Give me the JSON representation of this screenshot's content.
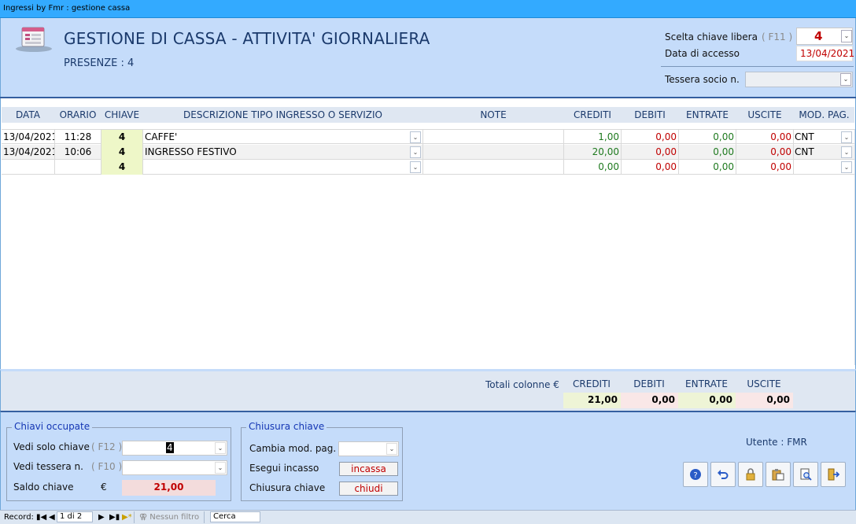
{
  "window": {
    "title": "Ingressi by Fmr : gestione cassa"
  },
  "header": {
    "title": "GESTIONE DI CASSA - ATTIVITA' GIORNALIERA",
    "presenze": "PRESENZE : 4",
    "scelta_label": "Scelta chiave libera",
    "scelta_hint": "( F11 )",
    "scelta_value": "4",
    "data_label": "Data di accesso",
    "data_value": "13/04/2021",
    "tessera_label": "Tessera socio n.",
    "tessera_value": ""
  },
  "grid": {
    "columns": [
      "DATA",
      "ORARIO",
      "CHIAVE",
      "DESCRIZIONE TIPO INGRESSO O SERVIZIO",
      "NOTE",
      "CREDITI",
      "DEBITI",
      "ENTRATE",
      "USCITE",
      "MOD. PAG."
    ],
    "rows": [
      {
        "data": "13/04/2021",
        "orario": "11:28",
        "chiave": "4",
        "descrizione": "CAFFE'",
        "note": "",
        "crediti": "1,00",
        "debiti": "0,00",
        "entrate": "0,00",
        "uscite": "0,00",
        "mod_pag": "CNT"
      },
      {
        "data": "13/04/2021",
        "orario": "10:06",
        "chiave": "4",
        "descrizione": "INGRESSO FESTIVO",
        "note": "",
        "crediti": "20,00",
        "debiti": "0,00",
        "entrate": "0,00",
        "uscite": "0,00",
        "mod_pag": "CNT"
      },
      {
        "data": "",
        "orario": "",
        "chiave": "4",
        "descrizione": "",
        "note": "",
        "crediti": "0,00",
        "debiti": "0,00",
        "entrate": "0,00",
        "uscite": "0,00",
        "mod_pag": ""
      }
    ]
  },
  "totals": {
    "label": "Totali colonne €",
    "headers": [
      "CREDITI",
      "DEBITI",
      "ENTRATE",
      "USCITE"
    ],
    "crediti": "21,00",
    "debiti": "0,00",
    "entrate": "0,00",
    "uscite": "0,00"
  },
  "chiavi_occupate": {
    "legend": "Chiavi occupate",
    "vedi_chiave_label": "Vedi solo chiave",
    "vedi_chiave_hint": "( F12 )",
    "vedi_chiave_value": "4",
    "vedi_tessera_label": "Vedi tessera n.",
    "vedi_tessera_hint": "( F10 )",
    "saldo_label": "Saldo chiave",
    "saldo_currency": "€",
    "saldo_value": "21,00"
  },
  "chiusura": {
    "legend": "Chiusura chiave",
    "cambia_label": "Cambia mod. pag.",
    "esegui_label": "Esegui incasso",
    "esegui_button": "incassa",
    "chiusura_label": "Chiusura chiave",
    "chiusura_button": "chiudi"
  },
  "utente": "Utente : FMR",
  "toolbar_icons": [
    "help-icon",
    "undo-icon",
    "lock-icon",
    "paste-icon",
    "print-preview-icon",
    "exit-icon"
  ],
  "statusbar": {
    "record_label": "Record:",
    "position": "1 di 2",
    "filter": "Nessun filtro",
    "search": "Cerca"
  }
}
